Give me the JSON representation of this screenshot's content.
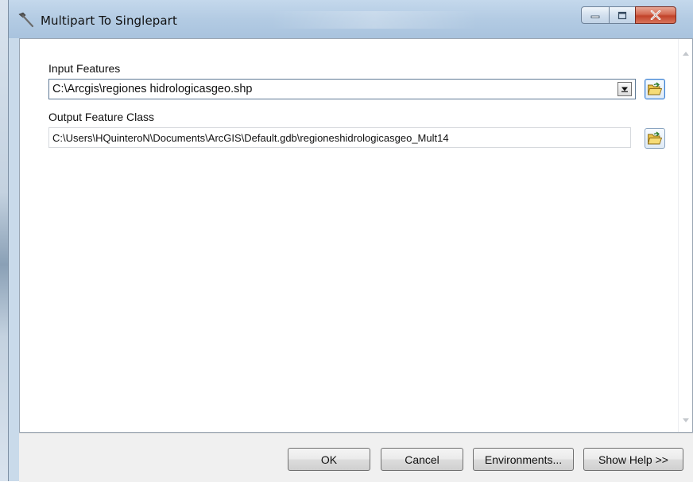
{
  "window": {
    "title": "Multipart To Singlepart"
  },
  "form": {
    "input_label": "Input Features",
    "input_value": "C:\\Arcgis\\regiones hidrologicasgeo.shp",
    "output_label": "Output Feature Class",
    "output_value": "C:\\Users\\HQuinteroN\\Documents\\ArcGIS\\Default.gdb\\regioneshidrologicasgeo_Mult14"
  },
  "buttons": {
    "ok": "OK",
    "cancel": "Cancel",
    "environments": "Environments...",
    "show_help": "Show Help >>"
  },
  "icons": {
    "title": "hammer-icon",
    "browse": "open-folder-icon",
    "dropdown": "chevron-down-icon",
    "minimize": "minimize-icon",
    "maximize": "maximize-icon",
    "close": "close-icon"
  },
  "colors": {
    "titlebar": "#b3cbe3",
    "close_button": "#c2432a",
    "panel": "#ffffff",
    "footer": "#f0f0f0"
  }
}
